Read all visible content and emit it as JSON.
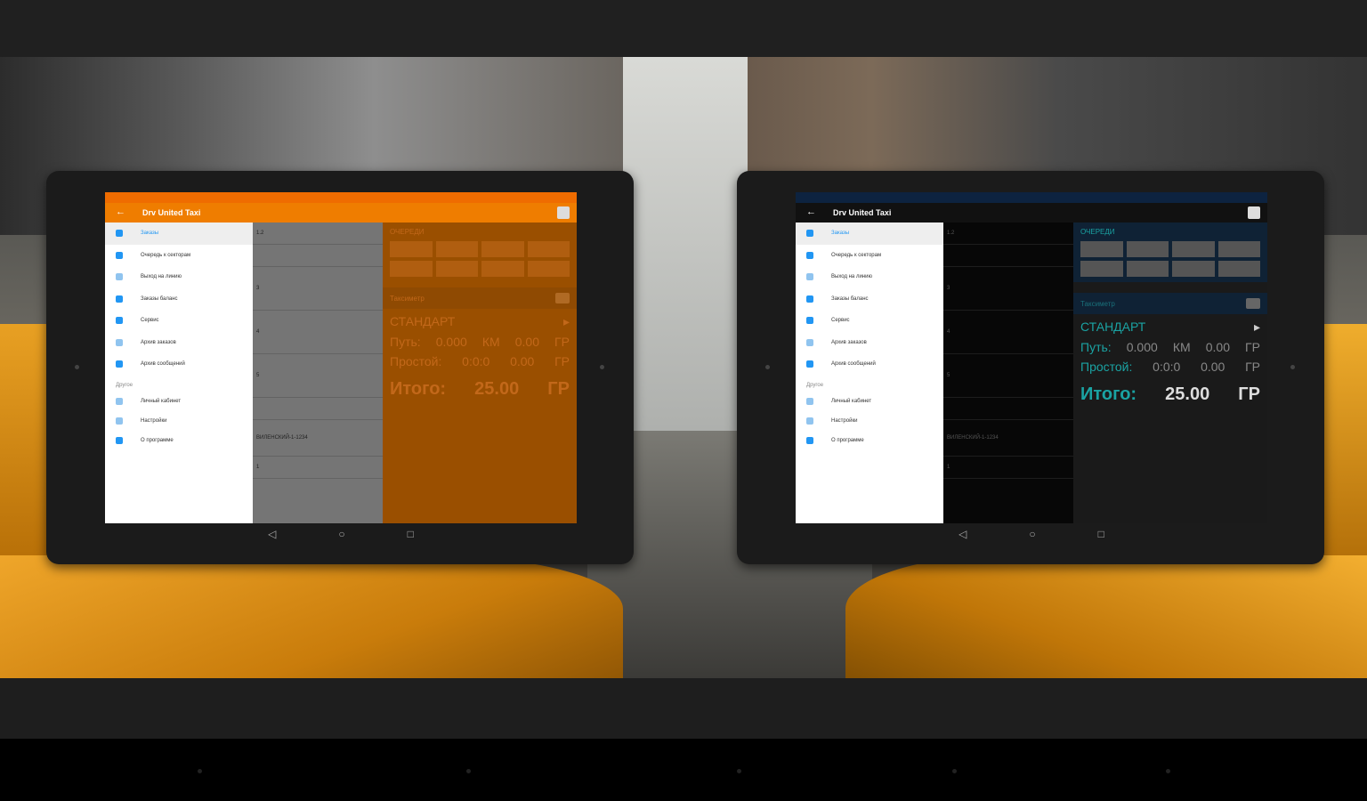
{
  "tablets": [
    {
      "theme": "orange",
      "app_title": "Drv United Taxi",
      "drawer": {
        "items": [
          "Заказы",
          "Очередь к секторам",
          "Выход на линию",
          "Заказы баланс",
          "Сервис",
          "Архив заказов",
          "Архив сообщений"
        ],
        "subheader": "Другое",
        "extra_items": [
          "Личный кабинет",
          "Настройки",
          "О программе"
        ]
      },
      "mid_rows": [
        "1.2",
        "",
        "3",
        "4",
        "5",
        "",
        "ВИЛЕНСКИЙ-1-1234",
        "1"
      ],
      "orders_title": "ОЧЕРЕДИ",
      "taximeter": {
        "header": "Таксиметр",
        "tariff": "СТАНДАРТ",
        "path_label": "Путь:",
        "path_value": "0.000",
        "path_unit": "КМ",
        "path_cost": "0.00",
        "path_currency": "ГР",
        "idle_label": "Простой:",
        "idle_value": "0:0:0",
        "idle_cost": "0.00",
        "idle_currency": "ГР",
        "total_label": "Итого:",
        "total_value": "25.00",
        "total_currency": "ГР"
      }
    },
    {
      "theme": "dark",
      "app_title": "Drv United Taxi",
      "drawer": {
        "items": [
          "Заказы",
          "Очередь к секторам",
          "Выход на линию",
          "Заказы баланс",
          "Сервис",
          "Архив заказов",
          "Архив сообщений"
        ],
        "subheader": "Другое",
        "extra_items": [
          "Личный кабинет",
          "Настройки",
          "О программе"
        ]
      },
      "mid_rows": [
        "1.2",
        "",
        "3",
        "4",
        "5",
        "",
        "ВИЛЕНСКИЙ-1-1234",
        "1"
      ],
      "orders_title": "ОЧЕРЕДИ",
      "taximeter": {
        "header": "Таксиметр",
        "tariff": "СТАНДАРТ",
        "path_label": "Путь:",
        "path_value": "0.000",
        "path_unit": "КМ",
        "path_cost": "0.00",
        "path_currency": "ГР",
        "idle_label": "Простой:",
        "idle_value": "0:0:0",
        "idle_cost": "0.00",
        "idle_currency": "ГР",
        "total_label": "Итого:",
        "total_value": "25.00",
        "total_currency": "ГР"
      }
    }
  ],
  "colors": {
    "orange_accent": "#ef7d00",
    "dark_accent": "#1aa3a3",
    "taxi_yellow": "#f0a72b"
  },
  "icons": {
    "back": "arrow-left-icon",
    "nav": [
      "nav-back-icon",
      "nav-home-icon",
      "nav-recents-icon"
    ]
  }
}
